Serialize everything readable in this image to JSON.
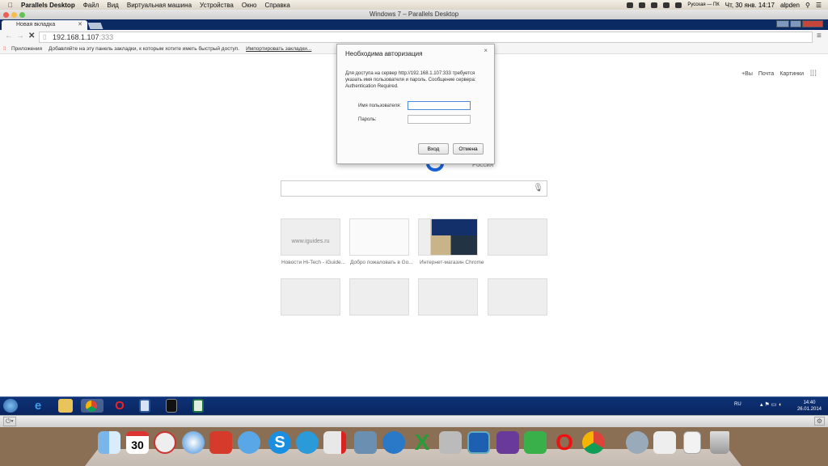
{
  "menubar": {
    "app": "Parallels Desktop",
    "items": [
      "Файл",
      "Вид",
      "Виртуальная машина",
      "Устройства",
      "Окно",
      "Справка"
    ],
    "input_source": "Русская — ПК",
    "datetime": "Чт, 30 янв. 14:17",
    "user": "alpden"
  },
  "window": {
    "title": "Windows 7 – Parallels Desktop"
  },
  "browser": {
    "tab_title": "Новая вкладка",
    "url_host": "192.168.1.107",
    "url_port": ":333",
    "bookmarks": {
      "apps": "Приложения",
      "hint": "Добавляйте на эту панель закладки, к которым хотите иметь быстрый доступ.",
      "import": "Импортировать закладки..."
    }
  },
  "google": {
    "links": [
      "+Вы",
      "Почта",
      "Картинки"
    ],
    "logo_suffix": "Россия"
  },
  "tiles": [
    {
      "label": "Новости Hi-Tech - iGuide...",
      "thumb_text": "www.iguides.ru"
    },
    {
      "label": "Добро пожаловать в Go..."
    },
    {
      "label": "Интернет-магазин Chrome"
    },
    {
      "label": ""
    },
    {
      "label": ""
    },
    {
      "label": ""
    },
    {
      "label": ""
    },
    {
      "label": ""
    }
  ],
  "dialog": {
    "title": "Необходима авторизация",
    "message": "Для доступа на сервер http://192.168.1.107:333 требуется указать имя пользователя и пароль. Сообщение сервера: Authentication Required.",
    "username_label": "Имя пользователя:",
    "password_label": "Пароль:",
    "username_value": "",
    "password_value": "",
    "login": "Вход",
    "cancel": "Отмена",
    "close": "×"
  },
  "taskbar": {
    "lang": "RU",
    "time": "14:40",
    "date": "26.01.2014",
    "apps": [
      "start",
      "internet-explorer",
      "explorer",
      "chrome",
      "opera",
      "word",
      "cmd",
      "excel"
    ]
  },
  "dock": {
    "apps": [
      "finder",
      "calendar",
      "mail",
      "safari",
      "evernote-skitch",
      "messages",
      "skype",
      "telegram",
      "parallels",
      "iphoto",
      "itunes",
      "excel",
      "fun",
      "pages",
      "photo-edit",
      "evernote",
      "opera",
      "chrome",
      "quicktime",
      "preview",
      "txt-file",
      "trash"
    ],
    "calendar_day": "30"
  }
}
